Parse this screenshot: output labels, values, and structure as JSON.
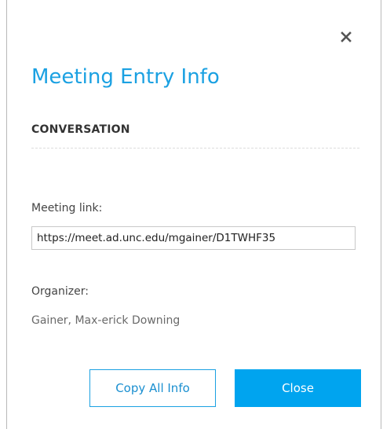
{
  "dialog": {
    "title": "Meeting Entry Info",
    "section_heading": "CONVERSATION",
    "meeting_link_label": "Meeting link:",
    "meeting_link_value": "https://meet.ad.unc.edu/mgainer/D1TWHF35",
    "organizer_label": "Organizer:",
    "organizer_value": "Gainer, Max-erick Downing",
    "copy_button_label": "Copy All Info",
    "close_button_label": "Close",
    "close_icon": "close-icon"
  },
  "colors": {
    "accent": "#1ba1e2",
    "primary_button": "#00a4ef",
    "heading_text": "#333333",
    "muted_text": "#6a6a6a"
  }
}
